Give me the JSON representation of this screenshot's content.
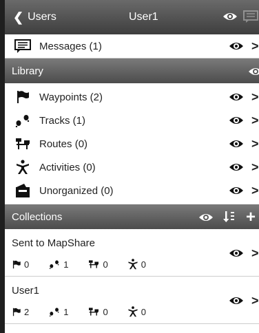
{
  "header": {
    "back_label": "Users",
    "title": "User1"
  },
  "messages": {
    "label": "Messages (1)"
  },
  "library": {
    "heading": "Library",
    "items": [
      {
        "label": "Waypoints (2)",
        "icon": "flag-icon"
      },
      {
        "label": "Tracks (1)",
        "icon": "footprints-icon"
      },
      {
        "label": "Routes (0)",
        "icon": "routes-icon"
      },
      {
        "label": "Activities (0)",
        "icon": "activity-person-icon"
      },
      {
        "label": "Unorganized (0)",
        "icon": "folder-icon"
      }
    ]
  },
  "collections": {
    "heading": "Collections",
    "items": [
      {
        "name": "Sent to MapShare",
        "waypoints": "0",
        "tracks": "1",
        "routes": "0",
        "activities": "0"
      },
      {
        "name": "User1",
        "waypoints": "2",
        "tracks": "1",
        "routes": "0",
        "activities": "0"
      }
    ]
  }
}
